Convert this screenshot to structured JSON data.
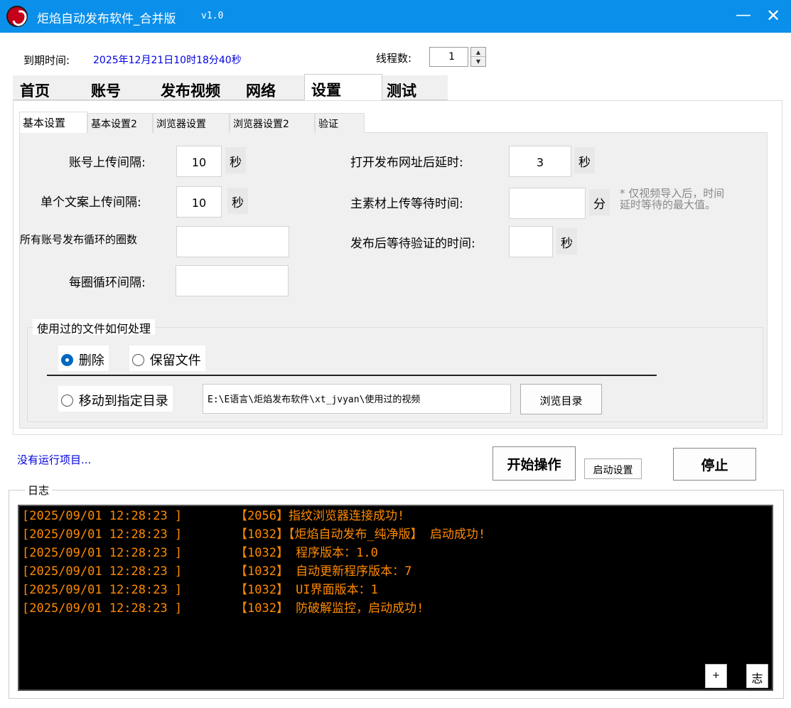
{
  "window": {
    "title": "炬焰自动发布软件_合并版",
    "version": "v1.0",
    "minimize": "—",
    "close": "✕"
  },
  "header": {
    "expiry_label": "到期时间:",
    "expiry_value": "2025年12月21日10时18分40秒",
    "threads_label": "线程数:",
    "threads_value": "1"
  },
  "main_tabs": [
    "首页",
    "账号",
    "发布视频",
    "网络",
    "设置",
    "测试"
  ],
  "active_main_tab": "设置",
  "sub_tabs": [
    "基本设置",
    "基本设置2",
    "浏览器设置",
    "浏览器设置2",
    "验证"
  ],
  "active_sub_tab": "基本设置",
  "settings": {
    "account_interval_label": "账号上传间隔:",
    "account_interval_value": "10",
    "account_interval_unit": "秒",
    "copy_interval_label": "单个文案上传间隔:",
    "copy_interval_value": "10",
    "copy_interval_unit": "秒",
    "loop_count_label": "所有账号发布循环的圈数",
    "loop_count_value": "",
    "loop_interval_label": "每圈循环间隔:",
    "loop_interval_value": "",
    "open_delay_label": "打开发布网址后延时:",
    "open_delay_value": "3",
    "open_delay_unit": "秒",
    "main_wait_label": "主素材上传等待时间:",
    "main_wait_value": "",
    "main_wait_unit": "分",
    "main_wait_note_1": "* 仅视频导入后，时间",
    "main_wait_note_2": "延时等待的最大值。",
    "verify_wait_label": "发布后等待验证的时间:",
    "verify_wait_value": "",
    "verify_wait_unit": "秒"
  },
  "file_handling": {
    "title": "使用过的文件如何处理",
    "option_delete": "删除",
    "option_keep": "保留文件",
    "option_move": "移动到指定目录",
    "selected": "删除",
    "path_value": "E:\\E语言\\炬焰发布软件\\xt_jvyan\\使用过的视频",
    "browse_button": "浏览目录"
  },
  "status": {
    "text": "没有运行项目..."
  },
  "actions": {
    "start": "开始操作",
    "launch_settings": "启动设置",
    "stop": "停止"
  },
  "log": {
    "title": "日志",
    "entries": [
      {
        "time": "[2025/09/01 12:28:23 ]",
        "msg": "【2056】指纹浏览器连接成功!"
      },
      {
        "time": "[2025/09/01 12:28:23 ]",
        "msg": "【1032】【炬焰自动发布_纯净版】 启动成功!"
      },
      {
        "time": "[2025/09/01 12:28:23 ]",
        "msg": "【1032】 程序版本：1.0"
      },
      {
        "time": "[2025/09/01 12:28:23 ]",
        "msg": "【1032】 自动更新程序版本：7"
      },
      {
        "time": "[2025/09/01 12:28:23 ]",
        "msg": "【1032】 UI界面版本：1"
      },
      {
        "time": "[2025/09/01 12:28:23 ]",
        "msg": "【1032】 防破解监控，启动成功!"
      }
    ],
    "plus_button": "+",
    "log_button": "志"
  },
  "colors": {
    "titlebar": "#0a8fea",
    "log_text": "#ff8a00",
    "link_blue": "#0000e0"
  }
}
